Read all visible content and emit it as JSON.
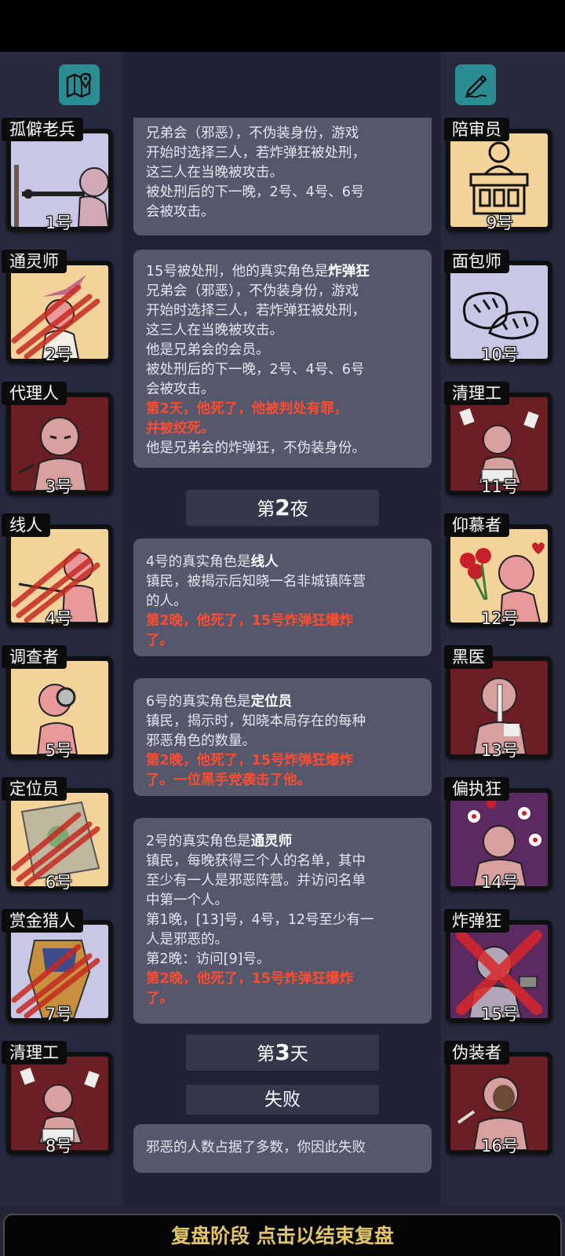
{
  "top_icons": [
    {
      "name": "map-pin-icon"
    },
    {
      "name": "pen-edit-icon"
    }
  ],
  "players_left": [
    {
      "role": "孤僻老兵",
      "number": "1号",
      "bg": "#c9c7e6",
      "dead": false
    },
    {
      "role": "通灵师",
      "number": "2号",
      "bg": "#f3d39a",
      "dead": true
    },
    {
      "role": "代理人",
      "number": "3号",
      "bg": "#6b1f25",
      "dead": false
    },
    {
      "role": "线人",
      "number": "4号",
      "bg": "#f3d39a",
      "dead": true
    },
    {
      "role": "调查者",
      "number": "5号",
      "bg": "#f3d39a",
      "dead": false
    },
    {
      "role": "定位员",
      "number": "6号",
      "bg": "#f3d39a",
      "dead": true
    },
    {
      "role": "赏金猎人",
      "number": "7号",
      "bg": "#c9c7e6",
      "dead": true
    },
    {
      "role": "清理工",
      "number": "8号",
      "bg": "#6b1f25",
      "dead": false
    }
  ],
  "players_right": [
    {
      "role": "陪审员",
      "number": "9号",
      "bg": "#f3d39a",
      "dead": false
    },
    {
      "role": "面包师",
      "number": "10号",
      "bg": "#c9c7e6",
      "dead": false
    },
    {
      "role": "清理工",
      "number": "11号",
      "bg": "#6b1f25",
      "dead": false
    },
    {
      "role": "仰慕者",
      "number": "12号",
      "bg": "#f3d39a",
      "dead": false
    },
    {
      "role": "黑医",
      "number": "13号",
      "bg": "#6b1f25",
      "dead": false
    },
    {
      "role": "偏执狂",
      "number": "14号",
      "bg": "#5c2a61",
      "dead": false
    },
    {
      "role": "炸弹狂",
      "number": "15号",
      "bg": "#5c2a61",
      "dead": true
    },
    {
      "role": "伪装者",
      "number": "16号",
      "bg": "#6b1f25",
      "dead": false
    }
  ],
  "log": {
    "entry1": {
      "l1": "兄弟会（邪恶），不伪装身份，游戏",
      "l2": "开始时选择三人，若炸弹狂被处刑，",
      "l3": "这三人在当晚被攻击。",
      "l4": "被处刑后的下一晚，2号、4号、6号",
      "l5": "会被攻击。"
    },
    "entry2": {
      "l1_pre": "15号被处刑，他的真实角色是",
      "l1_role": "炸弹狂",
      "l2": "兄弟会（邪恶），不伪装身份，游戏",
      "l3": "开始时选择三人，若炸弹狂被处刑，",
      "l4": "这三人在当晚被攻击。",
      "l5": "他是兄弟会的会员。",
      "l6": "被处刑后的下一晚，2号、4号、6号",
      "l7": "会被攻击。",
      "l8": "第2天，他死了，他被判处有罪，",
      "l9": "并被绞死。",
      "l10": "他是兄弟会的炸弹狂，不伪装身份。"
    },
    "night2": {
      "pre": "第",
      "num": "2",
      "post": "夜"
    },
    "entry3": {
      "l1_pre": "4号的真实角色是",
      "l1_role": "线人",
      "l2": "镇民，被揭示后知晓一名非城镇阵营",
      "l3": "的人。",
      "l4": "第2晚，他死了，15号炸弹狂爆炸",
      "l5": "了。"
    },
    "entry4": {
      "l1_pre": "6号的真实角色是",
      "l1_role": "定位员",
      "l2": "镇民，揭示时，知晓本局存在的每种",
      "l3": "邪恶角色的数量。",
      "l4": "第2晚，他死了，15号炸弹狂爆炸",
      "l5": "了。一位黑手党袭击了他。"
    },
    "entry5": {
      "l1_pre": "2号的真实角色是",
      "l1_role": "通灵师",
      "l2": "镇民，每晚获得三个人的名单，其中",
      "l3": "至少有一人是邪恶阵营。并访问名单",
      "l4": "中第一个人。",
      "l5": "第1晚，[13]号，4号，12号至少有一",
      "l6": "人是邪恶的。",
      "l7": "第2晚：访问[9]号。",
      "l8": "第2晚，他死了，15号炸弹狂爆炸",
      "l9": "了。"
    },
    "day3": {
      "pre": "第",
      "num": "3",
      "post": "天"
    },
    "result": "失败",
    "entry6": "邪恶的人数占据了多数，你因此失败"
  },
  "bottom_bar": "复盘阶段 点击以结束复盘",
  "colors": {
    "death_text": "#ff4b2e",
    "bottom_text": "#e2c56b",
    "icon_bg": "#2b8c94"
  }
}
